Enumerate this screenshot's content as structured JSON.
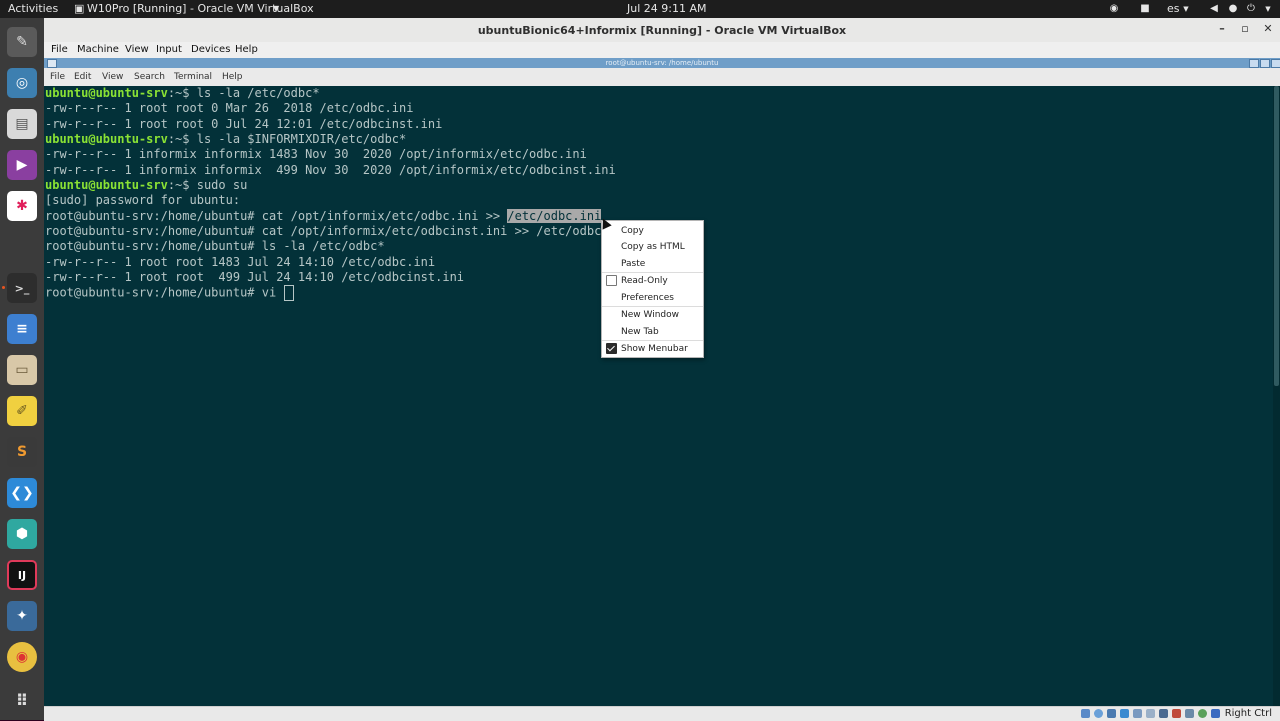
{
  "topbar": {
    "activities": "Activities",
    "app_title": "W10Pro [Running] - Oracle VM VirtualBox",
    "clock": "Jul 24  9:11 AM",
    "language": "es"
  },
  "vbox": {
    "title": "ubuntuBionic64+Informix [Running] - Oracle VM VirtualBox",
    "menu": [
      "File",
      "Machine",
      "View",
      "Input",
      "Devices",
      "Help"
    ],
    "host_key": "Right Ctrl"
  },
  "guest": {
    "window_title": "root@ubuntu-srv: /home/ubuntu",
    "menu": [
      "File",
      "Edit",
      "View",
      "Search",
      "Terminal",
      "Help"
    ]
  },
  "terminal": {
    "lines": [
      {
        "prompt": "ubuntu@ubuntu-srv",
        "rest": ":~$ ls -la /etc/odbc*"
      },
      {
        "text": "-rw-r--r-- 1 root root 0 Mar 26  2018 /etc/odbc.ini"
      },
      {
        "text": "-rw-r--r-- 1 root root 0 Jul 24 12:01 /etc/odbcinst.ini"
      },
      {
        "prompt": "ubuntu@ubuntu-srv",
        "rest": ":~$ ls -la $INFORMIXDIR/etc/odbc*"
      },
      {
        "text": "-rw-r--r-- 1 informix informix 1483 Nov 30  2020 /opt/informix/etc/odbc.ini"
      },
      {
        "text": "-rw-r--r-- 1 informix informix  499 Nov 30  2020 /opt/informix/etc/odbcinst.ini"
      },
      {
        "prompt": "ubuntu@ubuntu-srv",
        "rest": ":~$ sudo su"
      },
      {
        "text": "[sudo] password for ubuntu:"
      },
      {
        "text": "root@ubuntu-srv:/home/ubuntu# cat /opt/informix/etc/odbc.ini >> ",
        "selected": "/etc/odbc.ini"
      },
      {
        "text": "root@ubuntu-srv:/home/ubuntu# cat /opt/informix/etc/odbcinst.ini >> /etc/odbc"
      },
      {
        "text": "root@ubuntu-srv:/home/ubuntu# ls -la /etc/odbc*"
      },
      {
        "text": "-rw-r--r-- 1 root root 1483 Jul 24 14:10 /etc/odbc.ini"
      },
      {
        "text": "-rw-r--r-- 1 root root  499 Jul 24 14:10 /etc/odbcinst.ini"
      },
      {
        "text": "root@ubuntu-srv:/home/ubuntu# vi "
      }
    ]
  },
  "context_menu": {
    "copy": "Copy",
    "copy_html": "Copy as HTML",
    "paste": "Paste",
    "read_only": "Read-Only",
    "read_only_checked": false,
    "preferences": "Preferences",
    "new_window": "New Window",
    "new_tab": "New Tab",
    "show_menubar": "Show Menubar",
    "show_menubar_checked": true
  },
  "dock": [
    {
      "icon": "tools-icon",
      "color": "#5a5a5a"
    },
    {
      "icon": "screenshot-icon",
      "color": "#3d7fb0"
    },
    {
      "icon": "document-icon",
      "color": "#d9d9d9"
    },
    {
      "icon": "video-icon",
      "color": "#8a3fa0"
    },
    {
      "icon": "slack-icon",
      "color": "#ffffff"
    },
    {
      "icon": "terminal-icon",
      "color": "#2d2d2d"
    },
    {
      "icon": "text-editor-icon",
      "color": "#3d7fd0"
    },
    {
      "icon": "files-icon",
      "color": "#d8c8a8"
    },
    {
      "icon": "notes-icon",
      "color": "#f0d040"
    },
    {
      "icon": "sublime-icon",
      "color": "#f09a30"
    },
    {
      "icon": "vscode-icon",
      "color": "#2d8ad8"
    },
    {
      "icon": "cube-icon",
      "color": "#2fa8a0"
    },
    {
      "icon": "intellij-icon",
      "color": "#e03a5a"
    },
    {
      "icon": "mysql-workbench-icon",
      "color": "#3a6a9a"
    },
    {
      "icon": "chrome-icon",
      "color": "#e8c040"
    },
    {
      "icon": "app-grid-icon",
      "color": "#3b3b3b"
    }
  ]
}
